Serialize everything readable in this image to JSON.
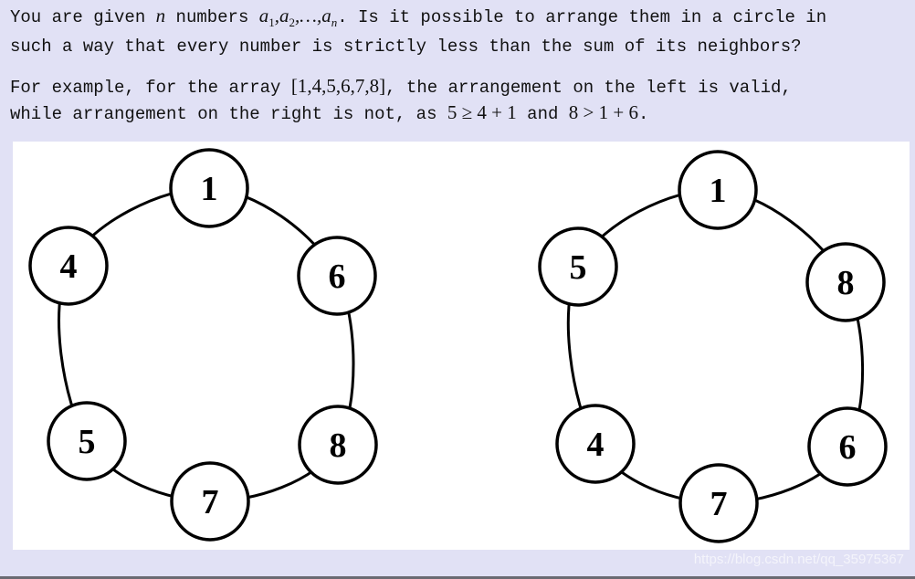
{
  "paragraph1": {
    "line1_a": "You are given ",
    "var_n": "n",
    "line1_b": " numbers ",
    "seq": "a1,a2,…,an",
    "line1_c": ". Is it possible to arrange them in a circle in",
    "line2": "such a way that every number is strictly less than the sum of its neighbors?"
  },
  "paragraph2": {
    "line1_a": "For example, for the array ",
    "array": "[1,4,5,6,7,8]",
    "line1_b": ", the arrangement on the left is valid,",
    "line2_a": "while arrangement on the right is not, as ",
    "ineq1": "5 ≥ 4 + 1",
    "line2_b": " and ",
    "ineq2": "8 > 1 + 6",
    "line2_c": "."
  },
  "figure": {
    "left_circle": [
      "1",
      "6",
      "8",
      "7",
      "5",
      "4"
    ],
    "right_circle": [
      "1",
      "8",
      "6",
      "7",
      "4",
      "5"
    ]
  },
  "watermark": "https://blog.csdn.net/qq_35975367"
}
